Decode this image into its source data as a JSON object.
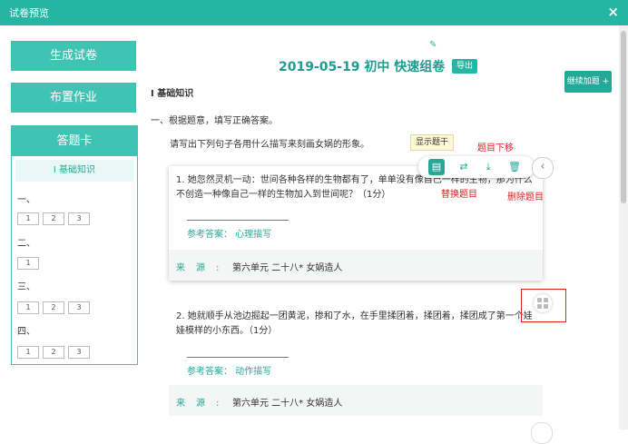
{
  "window": {
    "title": "试卷预览",
    "close": "×"
  },
  "sidebar": {
    "generate": "生成试卷",
    "assign": "布置作业",
    "card": {
      "title": "答题卡",
      "section": "Ⅰ 基础知识",
      "groups": [
        {
          "label": "一、",
          "nums": [
            "1",
            "2",
            "3"
          ]
        },
        {
          "label": "二、",
          "nums": [
            "1"
          ]
        },
        {
          "label": "三、",
          "nums": [
            "1",
            "2",
            "3"
          ]
        },
        {
          "label": "四、",
          "nums": [
            "1",
            "2",
            "3"
          ]
        }
      ]
    }
  },
  "header": {
    "title": "2019-05-19 初中 快速组卷",
    "export": "导出",
    "continue": "继续加题 +"
  },
  "section": "Ⅰ 基础知识",
  "part": {
    "title": "一、根据题意，填写正确答案。",
    "instruction": "请写出下列句子各用什么描写来刻画女娲的形象。",
    "show_answer": "显示题干"
  },
  "questions": [
    {
      "text": "1. 她忽然灵机一动：世间各种各样的生物都有了，单单没有像自己一样的生物，那为什么不创造一种像自己一样的生物加入到世间呢？（1分）",
      "answer": "参考答案：  心理描写",
      "source_label": "来源:",
      "source": "第六单元 二十八* 女娲造人"
    },
    {
      "text": "2. 她就顺手从池边掘起一团黄泥，掺和了水，在手里揉团着，揉团着，揉团成了第一个娃娃模样的小东西。（1分）",
      "answer": "参考答案：  动作描写",
      "source_label": "来源:",
      "source": "第六单元 二十八* 女娲造人"
    }
  ],
  "toolbar": {
    "icons": [
      "detail-icon",
      "swap-icon",
      "download-icon",
      "trash-icon"
    ]
  },
  "annotations": {
    "move_down": "题目下移",
    "replace": "替换题目",
    "delete": "删除题目"
  },
  "colors": {
    "teal": "#25b5a3",
    "button": "#3fc3b2",
    "annotation": "#e02020"
  }
}
